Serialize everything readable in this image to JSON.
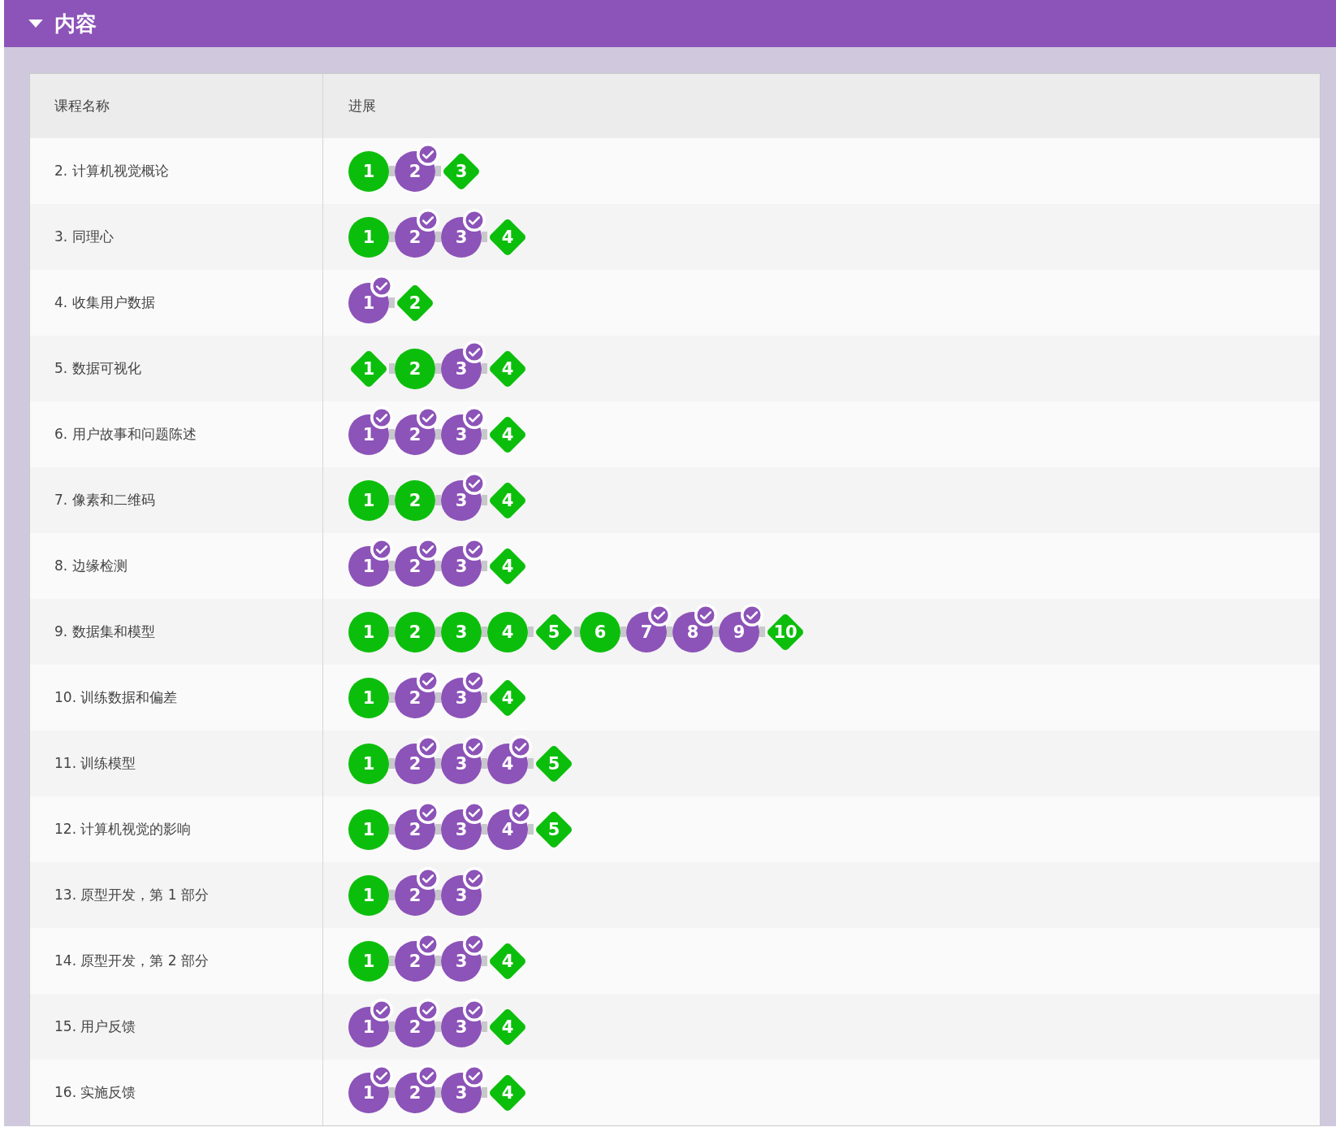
{
  "section": {
    "title": "内容",
    "expanded": true
  },
  "table": {
    "columns": [
      "课程名称",
      "进展"
    ],
    "rows": [
      {
        "name": "2. 计算机视觉概论",
        "steps": [
          {
            "label": "1",
            "kind": "circle",
            "completed": false
          },
          {
            "label": "2",
            "kind": "circle",
            "completed": true
          },
          {
            "label": "3",
            "kind": "diamond",
            "completed": false
          }
        ]
      },
      {
        "name": "3. 同理心",
        "steps": [
          {
            "label": "1",
            "kind": "circle",
            "completed": false
          },
          {
            "label": "2",
            "kind": "circle",
            "completed": true
          },
          {
            "label": "3",
            "kind": "circle",
            "completed": true
          },
          {
            "label": "4",
            "kind": "diamond",
            "completed": false
          }
        ]
      },
      {
        "name": "4. 收集用户数据",
        "steps": [
          {
            "label": "1",
            "kind": "circle",
            "completed": true
          },
          {
            "label": "2",
            "kind": "diamond",
            "completed": false
          }
        ]
      },
      {
        "name": "5. 数据可视化",
        "steps": [
          {
            "label": "1",
            "kind": "diamond",
            "completed": false
          },
          {
            "label": "2",
            "kind": "circle",
            "completed": false
          },
          {
            "label": "3",
            "kind": "circle",
            "completed": true
          },
          {
            "label": "4",
            "kind": "diamond",
            "completed": false
          }
        ]
      },
      {
        "name": "6. 用户故事和问题陈述",
        "steps": [
          {
            "label": "1",
            "kind": "circle",
            "completed": true
          },
          {
            "label": "2",
            "kind": "circle",
            "completed": true
          },
          {
            "label": "3",
            "kind": "circle",
            "completed": true
          },
          {
            "label": "4",
            "kind": "diamond",
            "completed": false
          }
        ]
      },
      {
        "name": "7. 像素和二维码",
        "steps": [
          {
            "label": "1",
            "kind": "circle",
            "completed": false
          },
          {
            "label": "2",
            "kind": "circle",
            "completed": false
          },
          {
            "label": "3",
            "kind": "circle",
            "completed": true
          },
          {
            "label": "4",
            "kind": "diamond",
            "completed": false
          }
        ]
      },
      {
        "name": "8. 边缘检测",
        "steps": [
          {
            "label": "1",
            "kind": "circle",
            "completed": true
          },
          {
            "label": "2",
            "kind": "circle",
            "completed": true
          },
          {
            "label": "3",
            "kind": "circle",
            "completed": true
          },
          {
            "label": "4",
            "kind": "diamond",
            "completed": false
          }
        ]
      },
      {
        "name": "9. 数据集和模型",
        "steps": [
          {
            "label": "1",
            "kind": "circle",
            "completed": false
          },
          {
            "label": "2",
            "kind": "circle",
            "completed": false
          },
          {
            "label": "3",
            "kind": "circle",
            "completed": false
          },
          {
            "label": "4",
            "kind": "circle",
            "completed": false
          },
          {
            "label": "5",
            "kind": "diamond",
            "completed": false
          },
          {
            "label": "6",
            "kind": "circle",
            "completed": false
          },
          {
            "label": "7",
            "kind": "circle",
            "completed": true
          },
          {
            "label": "8",
            "kind": "circle",
            "completed": true
          },
          {
            "label": "9",
            "kind": "circle",
            "completed": true
          },
          {
            "label": "10",
            "kind": "diamond",
            "completed": false
          }
        ]
      },
      {
        "name": "10. 训练数据和偏差",
        "steps": [
          {
            "label": "1",
            "kind": "circle",
            "completed": false
          },
          {
            "label": "2",
            "kind": "circle",
            "completed": true
          },
          {
            "label": "3",
            "kind": "circle",
            "completed": true
          },
          {
            "label": "4",
            "kind": "diamond",
            "completed": false
          }
        ]
      },
      {
        "name": "11. 训练模型",
        "steps": [
          {
            "label": "1",
            "kind": "circle",
            "completed": false
          },
          {
            "label": "2",
            "kind": "circle",
            "completed": true
          },
          {
            "label": "3",
            "kind": "circle",
            "completed": true
          },
          {
            "label": "4",
            "kind": "circle",
            "completed": true
          },
          {
            "label": "5",
            "kind": "diamond",
            "completed": false
          }
        ]
      },
      {
        "name": "12. 计算机视觉的影响",
        "steps": [
          {
            "label": "1",
            "kind": "circle",
            "completed": false
          },
          {
            "label": "2",
            "kind": "circle",
            "completed": true
          },
          {
            "label": "3",
            "kind": "circle",
            "completed": true
          },
          {
            "label": "4",
            "kind": "circle",
            "completed": true
          },
          {
            "label": "5",
            "kind": "diamond",
            "completed": false
          }
        ]
      },
      {
        "name": "13. 原型开发，第 1 部分",
        "steps": [
          {
            "label": "1",
            "kind": "circle",
            "completed": false
          },
          {
            "label": "2",
            "kind": "circle",
            "completed": true
          },
          {
            "label": "3",
            "kind": "circle",
            "completed": true
          }
        ]
      },
      {
        "name": "14. 原型开发，第 2 部分",
        "steps": [
          {
            "label": "1",
            "kind": "circle",
            "completed": false
          },
          {
            "label": "2",
            "kind": "circle",
            "completed": true
          },
          {
            "label": "3",
            "kind": "circle",
            "completed": true
          },
          {
            "label": "4",
            "kind": "diamond",
            "completed": false
          }
        ]
      },
      {
        "name": "15. 用户反馈",
        "steps": [
          {
            "label": "1",
            "kind": "circle",
            "completed": true
          },
          {
            "label": "2",
            "kind": "circle",
            "completed": true
          },
          {
            "label": "3",
            "kind": "circle",
            "completed": true
          },
          {
            "label": "4",
            "kind": "diamond",
            "completed": false
          }
        ]
      },
      {
        "name": "16. 实施反馈",
        "steps": [
          {
            "label": "1",
            "kind": "circle",
            "completed": true
          },
          {
            "label": "2",
            "kind": "circle",
            "completed": true
          },
          {
            "label": "3",
            "kind": "circle",
            "completed": true
          },
          {
            "label": "4",
            "kind": "diamond",
            "completed": false
          }
        ]
      }
    ]
  }
}
